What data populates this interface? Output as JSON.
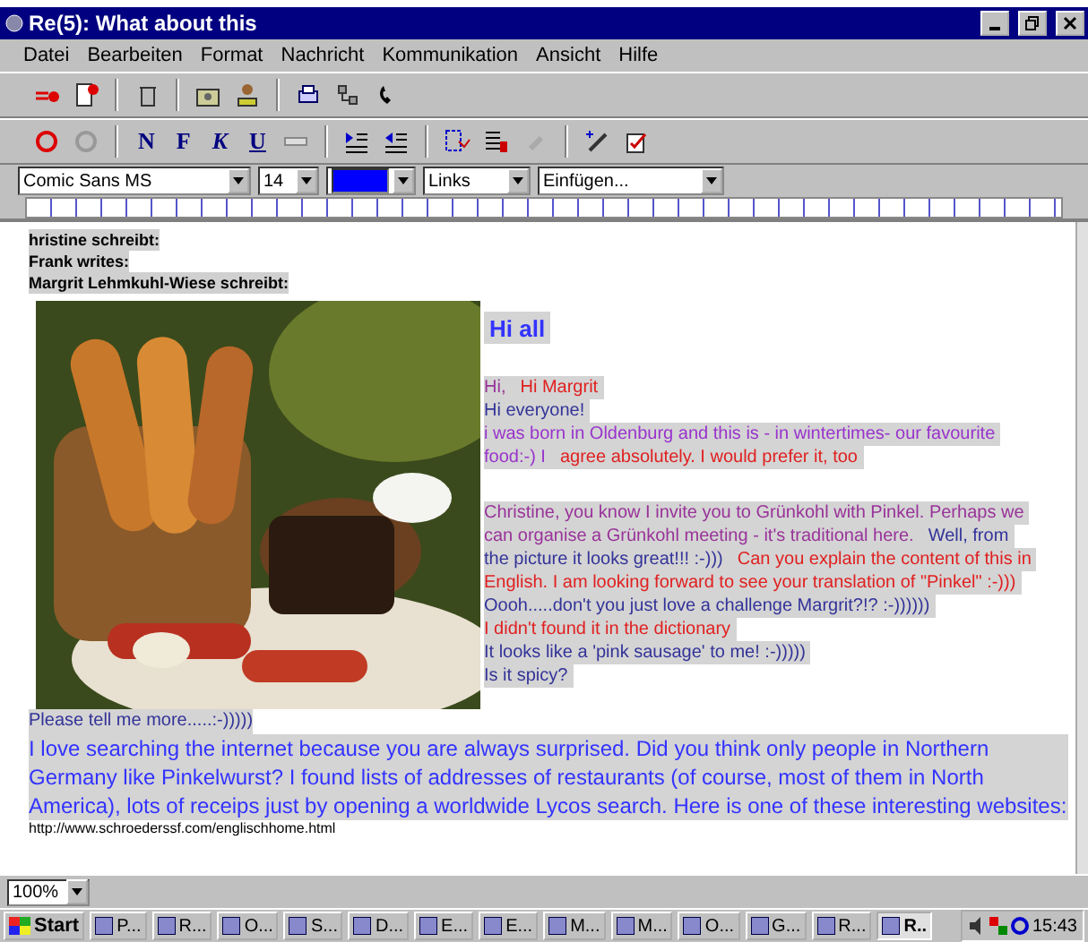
{
  "window": {
    "title": "Re(5): What about this"
  },
  "menu": [
    "Datei",
    "Bearbeiten",
    "Format",
    "Nachricht",
    "Kommunikation",
    "Ansicht",
    "Hilfe"
  ],
  "format_buttons": [
    {
      "label": "N",
      "kind": "normal"
    },
    {
      "label": "F",
      "kind": "bold"
    },
    {
      "label": "K",
      "kind": "italic"
    },
    {
      "label": "U",
      "kind": "underline"
    }
  ],
  "format_bar": {
    "font": "Comic Sans MS",
    "size": "14",
    "color": "#0000ff",
    "align": "Links",
    "insert": "Einfügen..."
  },
  "quote_headers": [
    "hristine schreibt:",
    "Frank writes:",
    "Margrit Lehmkuhl-Wiese schreibt:"
  ],
  "message_lines": [
    {
      "kind": "title",
      "highlighted": true,
      "segments": [
        {
          "text": "Hi all",
          "color": "#3333ff"
        }
      ]
    },
    {
      "kind": "blank"
    },
    {
      "kind": "text",
      "highlighted": true,
      "segments": [
        {
          "text": "Hi,",
          "color": "#993399"
        },
        {
          "text": "Hi Margrit",
          "color": "#e02020"
        }
      ]
    },
    {
      "kind": "text",
      "highlighted": true,
      "segments": [
        {
          "text": "Hi everyone!",
          "color": "#333399"
        }
      ]
    },
    {
      "kind": "text",
      "highlighted": true,
      "segments": [
        {
          "text": "i was born in Oldenburg and this is - in wintertimes- our favourite",
          "color": "#9933cc"
        }
      ]
    },
    {
      "kind": "text",
      "highlighted": true,
      "segments": [
        {
          "text": "food:-) I",
          "color": "#9933cc"
        },
        {
          "text": "agree absolutely. I would prefer it, too",
          "color": "#e02020"
        }
      ]
    },
    {
      "kind": "blank"
    },
    {
      "kind": "text",
      "highlighted": true,
      "segments": [
        {
          "text": "Christine, you know I invite you to Grünkohl with Pinkel. Perhaps we",
          "color": "#993399"
        }
      ]
    },
    {
      "kind": "text",
      "highlighted": true,
      "segments": [
        {
          "text": "can organise a  Grünkohl meeting - it's traditional here.",
          "color": "#993399"
        },
        {
          "text": "Well, from",
          "color": "#333399"
        }
      ]
    },
    {
      "kind": "text",
      "highlighted": true,
      "segments": [
        {
          "text": "the picture it looks great!!!  :-)))",
          "color": "#333399"
        },
        {
          "text": "Can you explain the content of this in",
          "color": "#e02020"
        }
      ]
    },
    {
      "kind": "text",
      "highlighted": true,
      "segments": [
        {
          "text": "English. I am looking forward to see your translation of \"Pinkel\" :-)))",
          "color": "#e02020"
        }
      ]
    },
    {
      "kind": "text",
      "highlighted": true,
      "segments": [
        {
          "text": "Oooh.....don't you just love a challenge Margrit?!?  :-))))))",
          "color": "#333399"
        }
      ]
    },
    {
      "kind": "text",
      "highlighted": true,
      "segments": [
        {
          "text": "I didn't found it in the dictionary",
          "color": "#e02020"
        }
      ]
    },
    {
      "kind": "text",
      "highlighted": true,
      "segments": [
        {
          "text": "It looks like a 'pink sausage' to me! :-)))))",
          "color": "#333399"
        }
      ]
    },
    {
      "kind": "text",
      "highlighted": true,
      "segments": [
        {
          "text": "Is it spicy?",
          "color": "#333399"
        }
      ]
    }
  ],
  "closing": [
    {
      "kind": "text",
      "highlighted": true,
      "text": "Please tell me more.....:-)))))",
      "color": "#333399"
    },
    {
      "kind": "paragraph",
      "highlighted": true,
      "text": "I love searching the internet because you are always surprised. Did you think only people in Northern Germany like Pinkelwurst? I found lists of addresses of restaurants (of course, most of them in North America), lots of receips just by opening a worldwide Lycos search. Here is one of these interesting websites:",
      "color": "#3333ff"
    },
    {
      "kind": "link",
      "highlighted": false,
      "text": "http://www.schroederssf.com/englischhome.html",
      "color": "#000000"
    }
  ],
  "zoom": "100%",
  "taskbar": {
    "start": "Start",
    "clock": "15:43",
    "tasks": [
      {
        "label": "P...",
        "selected": false
      },
      {
        "label": "R...",
        "selected": false
      },
      {
        "label": "O...",
        "selected": false
      },
      {
        "label": "S...",
        "selected": false
      },
      {
        "label": "D...",
        "selected": false
      },
      {
        "label": "E...",
        "selected": false
      },
      {
        "label": "E...",
        "selected": false
      },
      {
        "label": "M...",
        "selected": false
      },
      {
        "label": "M...",
        "selected": false
      },
      {
        "label": "O...",
        "selected": false
      },
      {
        "label": "G...",
        "selected": false
      },
      {
        "label": "R...",
        "selected": false
      },
      {
        "label": "R..",
        "selected": true
      }
    ]
  }
}
